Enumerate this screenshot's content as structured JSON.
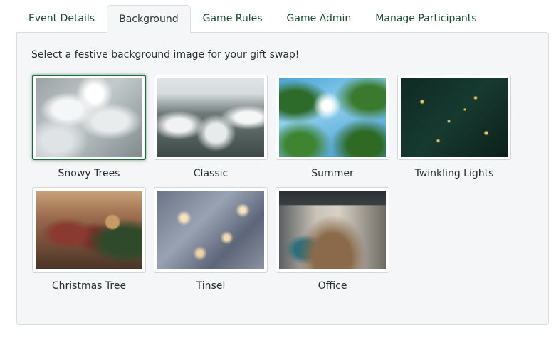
{
  "tabs": [
    {
      "label": "Event Details",
      "active": false
    },
    {
      "label": "Background",
      "active": true
    },
    {
      "label": "Game Rules",
      "active": false
    },
    {
      "label": "Game Admin",
      "active": false
    },
    {
      "label": "Manage Participants",
      "active": false
    }
  ],
  "panel": {
    "instruction": "Select a festive background image for your gift swap!",
    "options": [
      {
        "label": "Snowy Trees",
        "image": "snowy-trees-image",
        "selected": true
      },
      {
        "label": "Classic",
        "image": "classic-image",
        "selected": false
      },
      {
        "label": "Summer",
        "image": "summer-image",
        "selected": false
      },
      {
        "label": "Twinkling Lights",
        "image": "twinkling-lights-image",
        "selected": false
      },
      {
        "label": "Christmas Tree",
        "image": "christmas-tree-image",
        "selected": false
      },
      {
        "label": "Tinsel",
        "image": "tinsel-image",
        "selected": false
      },
      {
        "label": "Office",
        "image": "office-image",
        "selected": false
      }
    ]
  },
  "colors": {
    "accent": "#1e6b3f",
    "tab_text": "#1e4a33",
    "panel_bg": "#f5f6f7",
    "border": "#d9dde0"
  }
}
